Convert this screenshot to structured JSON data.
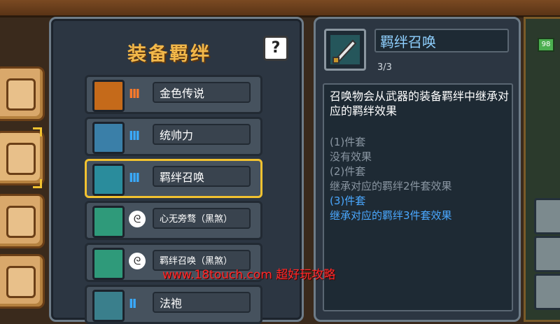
{
  "panel": {
    "title": "装备羁绊",
    "help_label": "?"
  },
  "bonds": [
    {
      "name": "金色传说",
      "icon": "flame-orb-icon",
      "level_icon": "bars-icon",
      "level_color": "#ff7a2a",
      "level_glyph": "III"
    },
    {
      "name": "统帅力",
      "icon": "trophy-icon",
      "level_icon": "bars-icon",
      "level_color": "#3aaaff",
      "level_glyph": "III"
    },
    {
      "name": "羁绊召唤",
      "icon": "summon-sword-icon",
      "level_icon": "bars-icon",
      "level_color": "#3aaaff",
      "level_glyph": "III",
      "selected": true
    },
    {
      "name": "心无旁骛（黑煞）",
      "icon": "hero-portrait-icon",
      "level_icon": "swirl-icon",
      "level_glyph": "ᘓ"
    },
    {
      "name": "羁绊召唤（黑煞）",
      "icon": "summon-sword-icon",
      "level_icon": "swirl-icon",
      "level_glyph": "ᘓ"
    },
    {
      "name": "法袍",
      "icon": "robe-icon",
      "level_icon": "bars-icon",
      "level_color": "#3aaaff",
      "level_glyph": "II"
    }
  ],
  "detail": {
    "name": "羁绊召唤",
    "count": "3/3",
    "description": "召唤物会从武器的装备羁绊中继承对应的羁绊效果",
    "tiers": [
      {
        "text": "(1)件套",
        "color": "#8a96a2"
      },
      {
        "text": "没有效果",
        "color": "#8a96a2"
      },
      {
        "text": "(2)件套",
        "color": "#8a96a2"
      },
      {
        "text": "继承对应的羁绊2件套效果",
        "color": "#8a96a2"
      },
      {
        "text": "(3)件套",
        "color": "#4aa8ff"
      },
      {
        "text": "继承对应的羁绊3件套效果",
        "color": "#4aa8ff"
      }
    ]
  },
  "badge": "98",
  "watermark": "www.18touch.com 超好玩攻略"
}
